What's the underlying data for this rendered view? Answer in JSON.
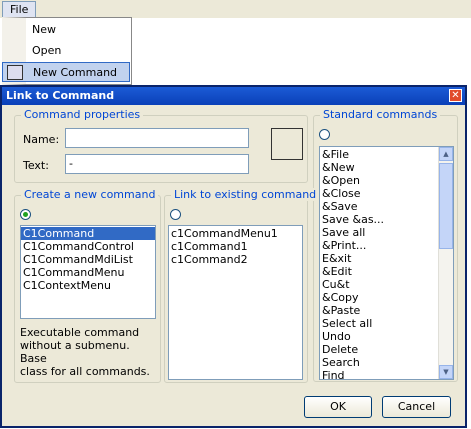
{
  "menu": {
    "file_label": "File",
    "items": [
      "New",
      "Open",
      "New Command"
    ]
  },
  "dialog": {
    "title": "Link to Command",
    "close_glyph": "✕",
    "command_properties": {
      "group_label": "Command properties",
      "name_label": "Name:",
      "name_value": "",
      "text_label": "Text:",
      "text_value": "-"
    },
    "create_new": {
      "group_label": "Create a new command",
      "items": [
        "C1Command",
        "C1CommandControl",
        "C1CommandMdiList",
        "C1CommandMenu",
        "C1ContextMenu"
      ],
      "selected": "C1Command",
      "description": [
        "Executable command",
        "without a submenu. Base",
        "class for all commands."
      ]
    },
    "link_existing": {
      "group_label": "Link to existing command",
      "items": [
        "c1CommandMenu1",
        "c1Command1",
        "c1Command2"
      ]
    },
    "standard": {
      "group_label": "Standard commands",
      "items": [
        "&File",
        "&New",
        "&Open",
        "&Close",
        "&Save",
        "Save &as...",
        "Save all",
        "&Print...",
        "E&xit",
        "&Edit",
        "Cu&t",
        "&Copy",
        "&Paste",
        "Select all",
        "Undo",
        "Delete",
        "Search",
        "Find"
      ]
    },
    "ok_label": "OK",
    "cancel_label": "Cancel"
  }
}
